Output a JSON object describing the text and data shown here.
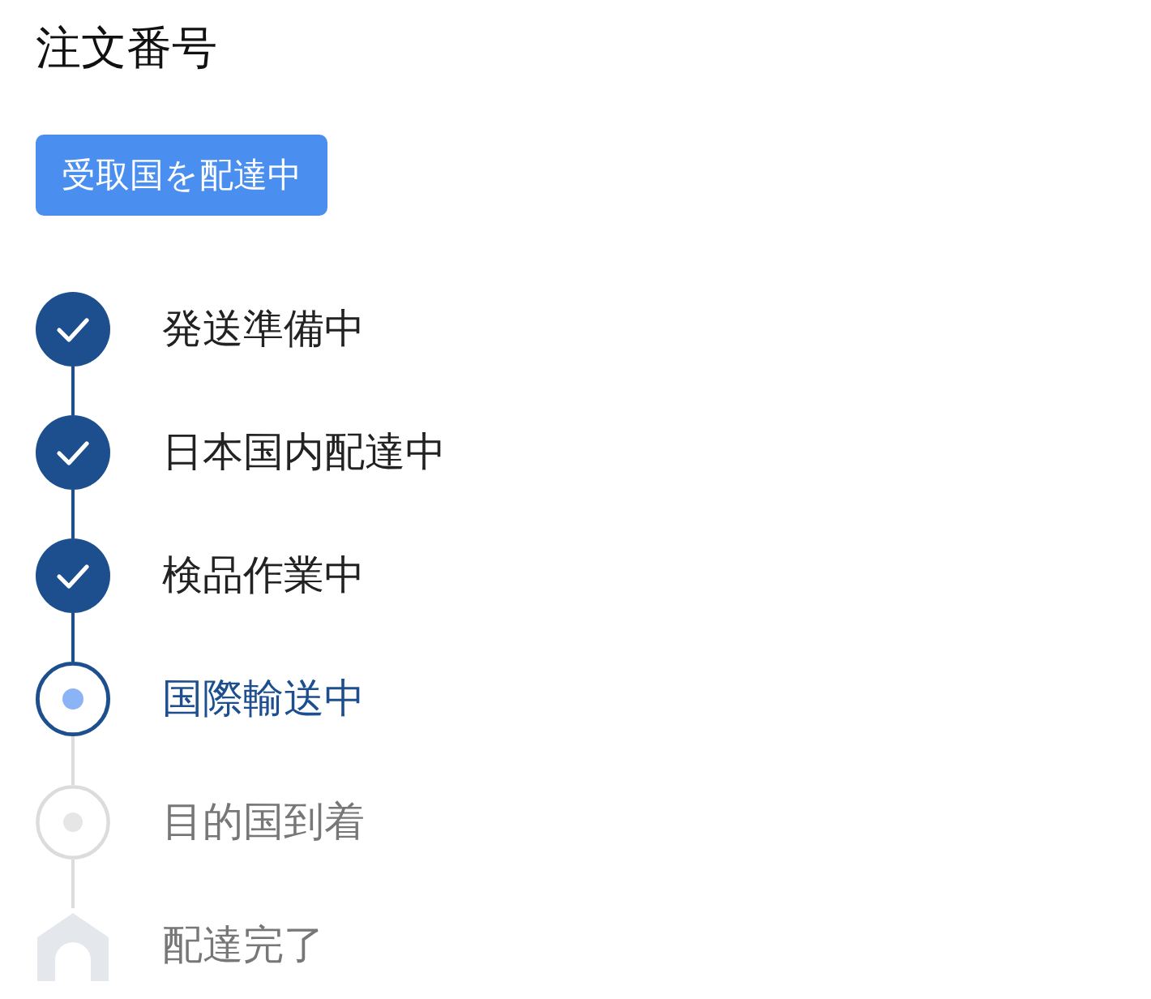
{
  "title": "注文番号",
  "status_badge": "受取国を配達中",
  "steps": [
    {
      "label": "発送準備中",
      "kind": "done"
    },
    {
      "label": "日本国内配達中",
      "kind": "done"
    },
    {
      "label": "検品作業中",
      "kind": "done"
    },
    {
      "label": "国際輸送中",
      "kind": "current"
    },
    {
      "label": "目的国到着",
      "kind": "pending"
    },
    {
      "label": "配達完了",
      "kind": "final"
    }
  ]
}
